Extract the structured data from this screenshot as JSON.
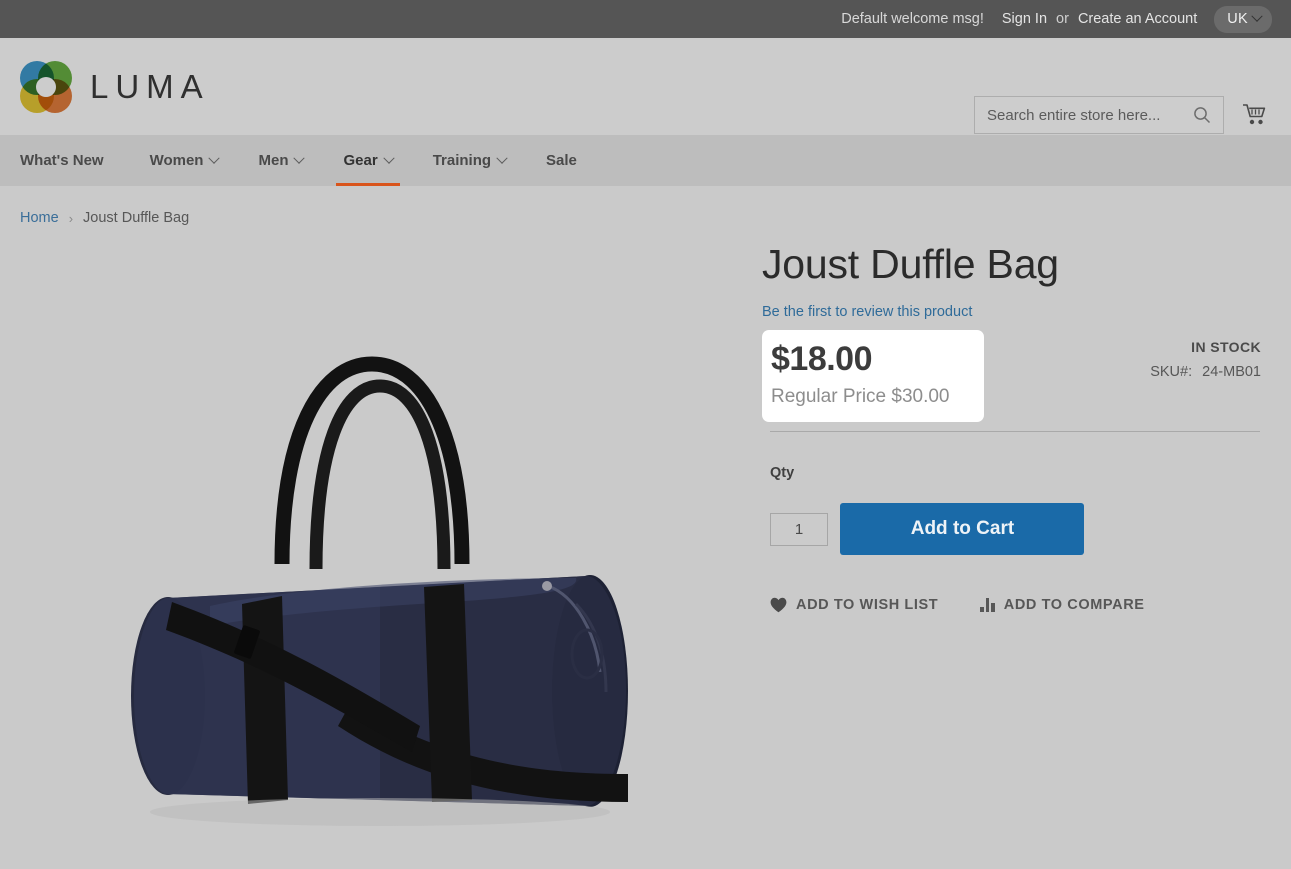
{
  "top_panel": {
    "welcome_message": "Default welcome msg!",
    "sign_in_label": "Sign In",
    "or_label": "or",
    "create_account_label": "Create an Account",
    "language": "UK"
  },
  "header": {
    "logo_text": "LUMA",
    "search": {
      "placeholder": "Search entire store here...",
      "value": ""
    }
  },
  "nav": {
    "items": [
      {
        "label": "What's New",
        "has_dropdown": false,
        "active": false
      },
      {
        "label": "Women",
        "has_dropdown": true,
        "active": false
      },
      {
        "label": "Men",
        "has_dropdown": true,
        "active": false
      },
      {
        "label": "Gear",
        "has_dropdown": true,
        "active": true
      },
      {
        "label": "Training",
        "has_dropdown": true,
        "active": false
      },
      {
        "label": "Sale",
        "has_dropdown": false,
        "active": false
      }
    ]
  },
  "breadcrumb": {
    "home_label": "Home",
    "separator": "›",
    "current_label": "Joust Duffle Bag"
  },
  "product": {
    "title": "Joust Duffle Bag",
    "review_link_label": "Be the first to review this product",
    "price": "$18.00",
    "regular_price_label": "Regular Price $30.00",
    "stock_status": "IN STOCK",
    "sku_label": "SKU#:",
    "sku_value": "24-MB01",
    "qty_label": "Qty",
    "qty_value": "1",
    "add_to_cart_label": "Add to Cart",
    "wishlist_label": "ADD TO WISH LIST",
    "compare_label": "ADD TO COMPARE",
    "image_alt": "Navy blue cylindrical duffle bag with black carry straps and shoulder strap"
  },
  "colors": {
    "top_panel_bg": "#555555",
    "header_bg": "#cccccc",
    "nav_bg": "#bdbdbd",
    "page_bg": "#cacaca",
    "accent_orange": "#d9541b",
    "link_blue": "#2f6b99",
    "button_blue": "#1a6aa8",
    "price_box_bg": "#ffffff"
  }
}
